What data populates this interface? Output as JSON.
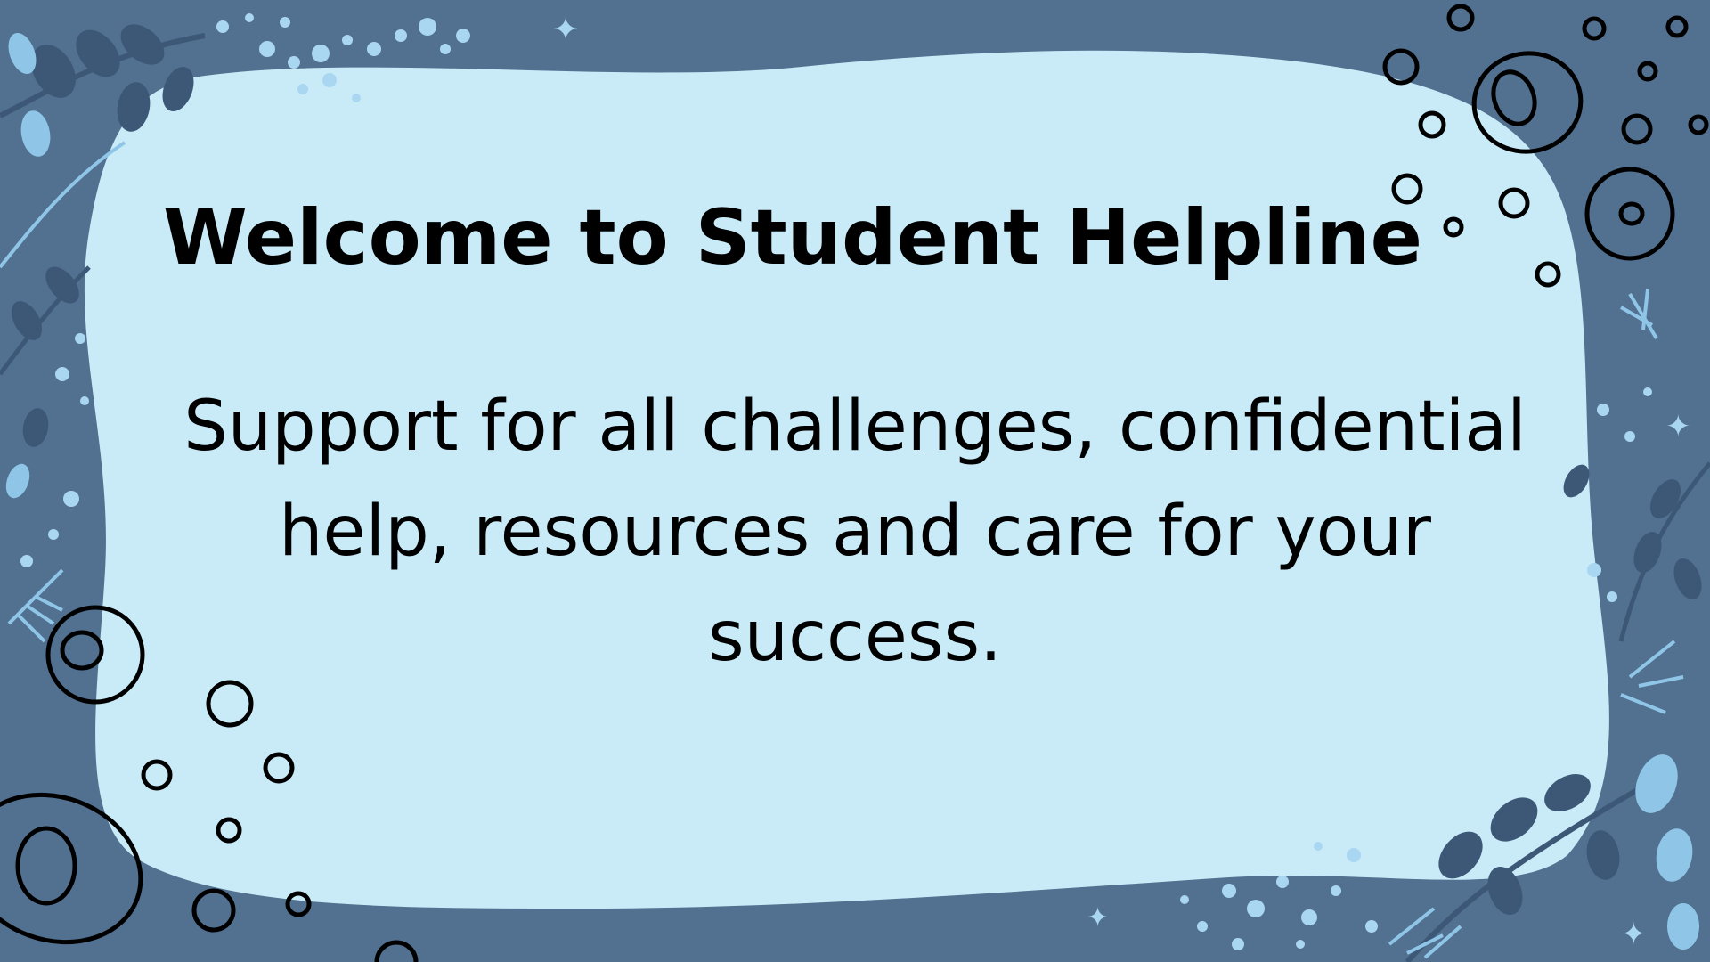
{
  "slide": {
    "title": "Welcome to Student Helpline",
    "subtitle": "Support for all challenges, confidential help, resources and care for your success."
  },
  "colors": {
    "background": "#52708f",
    "panel": "#c8ebf7",
    "leaf_dark": "#3d5877",
    "leaf_light": "#8fc6e8",
    "dots": "#a9d6f0",
    "ink": "#000000"
  }
}
